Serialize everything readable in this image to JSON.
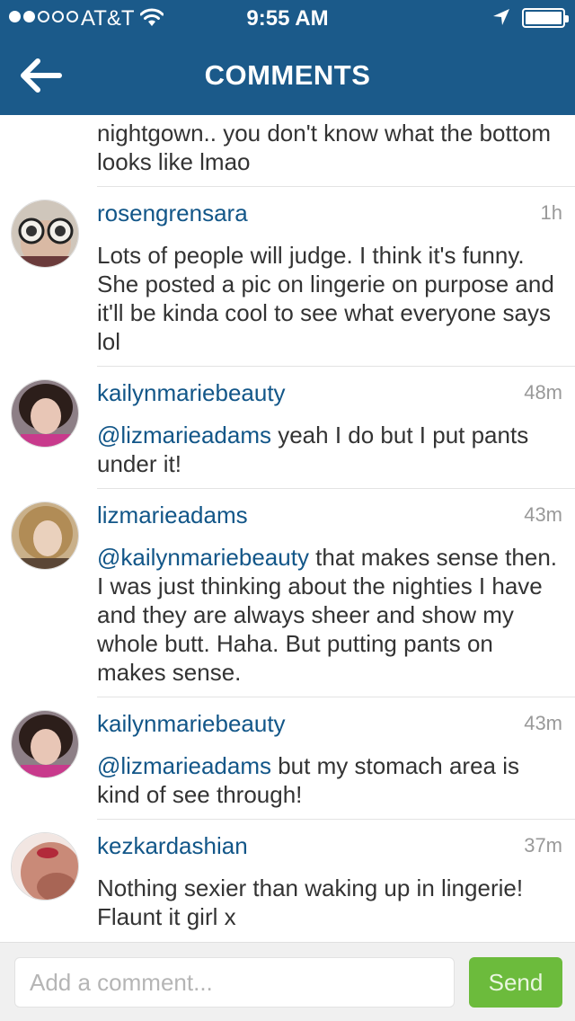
{
  "status_bar": {
    "carrier": "AT&T",
    "time": "9:55 AM",
    "signal_bars_filled": 2,
    "signal_bars_total": 5,
    "battery_level": 1.0
  },
  "header": {
    "title": "COMMENTS"
  },
  "partial_comment": {
    "text": "nightgown.. you don't know what the bottom looks like lmao"
  },
  "comments": [
    {
      "username": "rosengrensara",
      "time": "1h",
      "mention": "",
      "text": "Lots of people will judge.  I think it's funny.  She posted a pic on lingerie on purpose and it'll be kinda cool to see what everyone says lol"
    },
    {
      "username": "kailynmariebeauty",
      "time": "48m",
      "mention": "@lizmarieadams",
      "text": " yeah I do but I put pants under it!"
    },
    {
      "username": "lizmarieadams",
      "time": "43m",
      "mention": "@kailynmariebeauty",
      "text": " that makes sense then. I was just thinking about the nighties I have and they are always sheer and show my whole butt. Haha. But putting pants on makes sense."
    },
    {
      "username": "kailynmariebeauty",
      "time": "43m",
      "mention": "@lizmarieadams",
      "text": " but my stomach area is kind of see through!"
    },
    {
      "username": "kezkardashian",
      "time": "37m",
      "mention": "",
      "text": "Nothing sexier than waking up in lingerie! Flaunt it girl x"
    }
  ],
  "composer": {
    "placeholder": "Add a comment...",
    "value": "",
    "send_label": "Send"
  },
  "colors": {
    "header_bg": "#1b5a8a",
    "username": "#125688",
    "send_button": "#6cbb3c"
  }
}
